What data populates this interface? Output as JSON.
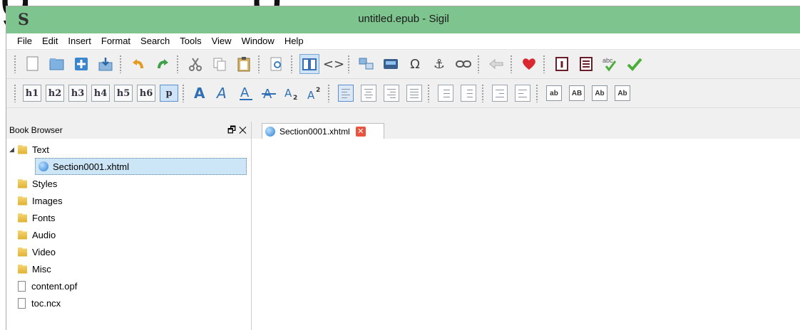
{
  "top_crop_text": "g… … … p",
  "window": {
    "app_logo": "S",
    "title": "untitled.epub - Sigil"
  },
  "menu": [
    "File",
    "Edit",
    "Insert",
    "Format",
    "Search",
    "Tools",
    "View",
    "Window",
    "Help"
  ],
  "toolbar1": {
    "icons": [
      "new-file-icon",
      "open-folder-icon",
      "add-file-icon",
      "save-icon",
      "undo-icon",
      "redo-icon",
      "cut-icon",
      "copy-icon",
      "paste-icon",
      "print-preview-icon",
      "book-view-icon",
      "code-view-icon",
      "split-icon",
      "insert-image-icon",
      "omega-icon",
      "anchor-icon",
      "link-icon",
      "back-arrow-icon",
      "heart-icon",
      "metadata-icon",
      "toc-icon",
      "spellcheck-icon",
      "validate-check-icon"
    ],
    "spellcheck_label": "abc",
    "code_glyph": "<>",
    "omega_glyph": "Ω",
    "anchor_glyph": "⚓"
  },
  "toolbar2": {
    "headings": [
      "h1",
      "h2",
      "h3",
      "h4",
      "h5",
      "h6",
      "p"
    ],
    "active_heading": "p",
    "text_style_icons": [
      "bold-icon",
      "italic-icon",
      "underline-icon",
      "strikethrough-icon",
      "subscript-icon",
      "superscript-icon"
    ],
    "case_buttons": [
      "ab",
      "AB",
      "Ab",
      "Ab"
    ]
  },
  "book_browser": {
    "title": "Book Browser",
    "float_icon": "🗗",
    "close_icon": "✕",
    "items": [
      {
        "label": "Text",
        "type": "folder",
        "expanded": true
      },
      {
        "label": "Section0001.xhtml",
        "type": "xhtml",
        "selected": true
      },
      {
        "label": "Styles",
        "type": "folder"
      },
      {
        "label": "Images",
        "type": "folder"
      },
      {
        "label": "Fonts",
        "type": "folder"
      },
      {
        "label": "Audio",
        "type": "folder"
      },
      {
        "label": "Video",
        "type": "folder"
      },
      {
        "label": "Misc",
        "type": "folder"
      },
      {
        "label": "content.opf",
        "type": "file"
      },
      {
        "label": "toc.ncx",
        "type": "file"
      }
    ]
  },
  "editor": {
    "tab_label": "Section0001.xhtml",
    "tab_close": "✕"
  },
  "colors": {
    "titlebar": "#7ec48e",
    "selection": "#cde6f7",
    "close_tab": "#e8543d",
    "heart": "#d9282f",
    "check": "#4cae3a"
  }
}
